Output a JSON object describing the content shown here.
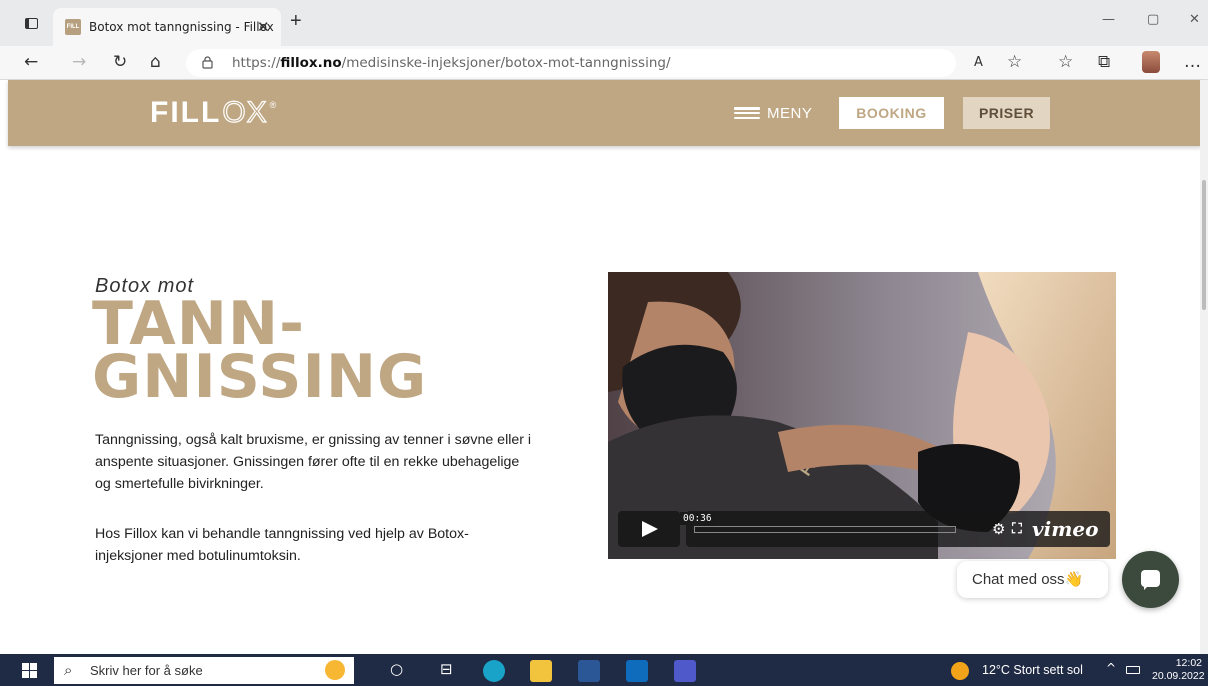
{
  "browser": {
    "tab_title": "Botox mot tanngnissing - Fillox",
    "tab_close": "✕",
    "new_tab": "+",
    "url_prefix": "https://",
    "url_domain": "fillox.no",
    "url_path": "/medisinske-injeksjoner/botox-mot-tanngnissing/",
    "window_controls": {
      "minimize": "—",
      "maximize": "▢",
      "close": "✕"
    },
    "nav_icons": {
      "back": "←",
      "forward": "→",
      "reload": "↻",
      "home": "⌂",
      "read_aloud": "A",
      "favorite": "☆",
      "favorites": "☆",
      "collections": "⧉",
      "more": "…"
    },
    "favicon_text": "FILL"
  },
  "site": {
    "logo": {
      "main": "FILL",
      "outlined": "OX",
      "registered": "®"
    },
    "nav": {
      "menu_label": "MENY",
      "booking_label": "BOOKING",
      "priser_label": "PRISER"
    },
    "colors": {
      "brand": "#bfa783",
      "accent_light": "#e2d6c2",
      "chat": "#3b4a3d"
    }
  },
  "hero": {
    "kicker": "Botox mot",
    "title_line1": "TANN-",
    "title_line2": "GNISSING",
    "paragraph1": "Tanngnissing, også kalt bruxisme, er gnissing av tenner i søvne eller i anspente situasjoner. Gnissingen fører ofte til en rekke ubehagelige og smertefulle bivirkninger.",
    "paragraph2": "Hos Fillox kan vi behandle tanngnissing ved hjelp av Botox-injeksjoner med botulinumtoksin."
  },
  "video": {
    "timecode": "00:36",
    "brand": "vimeo",
    "fullscreen_glyph": "⛶",
    "settings_glyph": "⚙",
    "progress": 0
  },
  "chat": {
    "label": "Chat med oss",
    "emoji": "👋"
  },
  "taskbar": {
    "search_placeholder": "Skriv her for å søke",
    "search_glyph": "⌕",
    "weather": "12°C  Stort sett sol",
    "time": "12:02",
    "date": "20.09.2022",
    "tray_up": "^",
    "taskview_glyph": "⊟",
    "cortana_glyph": "○"
  }
}
